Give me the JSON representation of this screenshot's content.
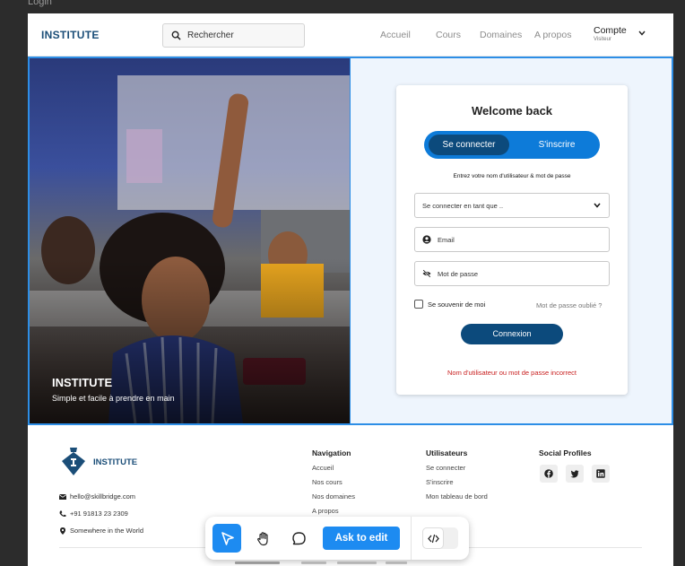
{
  "frame": {
    "label": "Login"
  },
  "header": {
    "logo": "INSTITUTE",
    "search_placeholder": "Rechercher",
    "nav": [
      "Accueil",
      "Cours",
      "Domaines",
      "A propos"
    ],
    "account": {
      "name": "Compte",
      "role": "Visiteur"
    }
  },
  "hero": {
    "title": "INSTITUTE",
    "subtitle": "Simple et facile à prendre en main"
  },
  "login": {
    "title": "Welcome back",
    "tabs": {
      "login": "Se connecter",
      "signup": "S'inscrire"
    },
    "instructions": "Entrez votre nom d'utilisateur & mot de passe",
    "role_select": "Se connecter en tant que ..",
    "email_placeholder": "Email",
    "password_placeholder": "Mot de passe",
    "remember": "Se souvenir de moi",
    "forgot": "Mot de passe oublié ?",
    "submit": "Connexion",
    "error": "Nom d'utilisateur ou mot de passe incorrect"
  },
  "footer": {
    "logo": "INSTITUTE",
    "email": "hello@skillbridge.com",
    "phone": "+91 91813 23 2309",
    "location": "Somewhere in the World",
    "navigation": {
      "title": "Navigation",
      "links": [
        "Accueil",
        "Nos cours",
        "Nos domaines",
        "A propos"
      ]
    },
    "users": {
      "title": "Utilisateurs",
      "links": [
        "Se connecter",
        "S'inscrire",
        "Mon tableau de bord"
      ]
    },
    "social": {
      "title": "Social Profiles",
      "icons": [
        "facebook-icon",
        "twitter-icon",
        "linkedin-icon"
      ]
    }
  },
  "toolbar": {
    "ask_label": "Ask to edit"
  },
  "colors": {
    "brand": "#1b4e78",
    "primary": "#0d7bd9",
    "dark_button": "#0c4a7c",
    "error": "#c81e1e",
    "selection": "#2d8ee6"
  }
}
